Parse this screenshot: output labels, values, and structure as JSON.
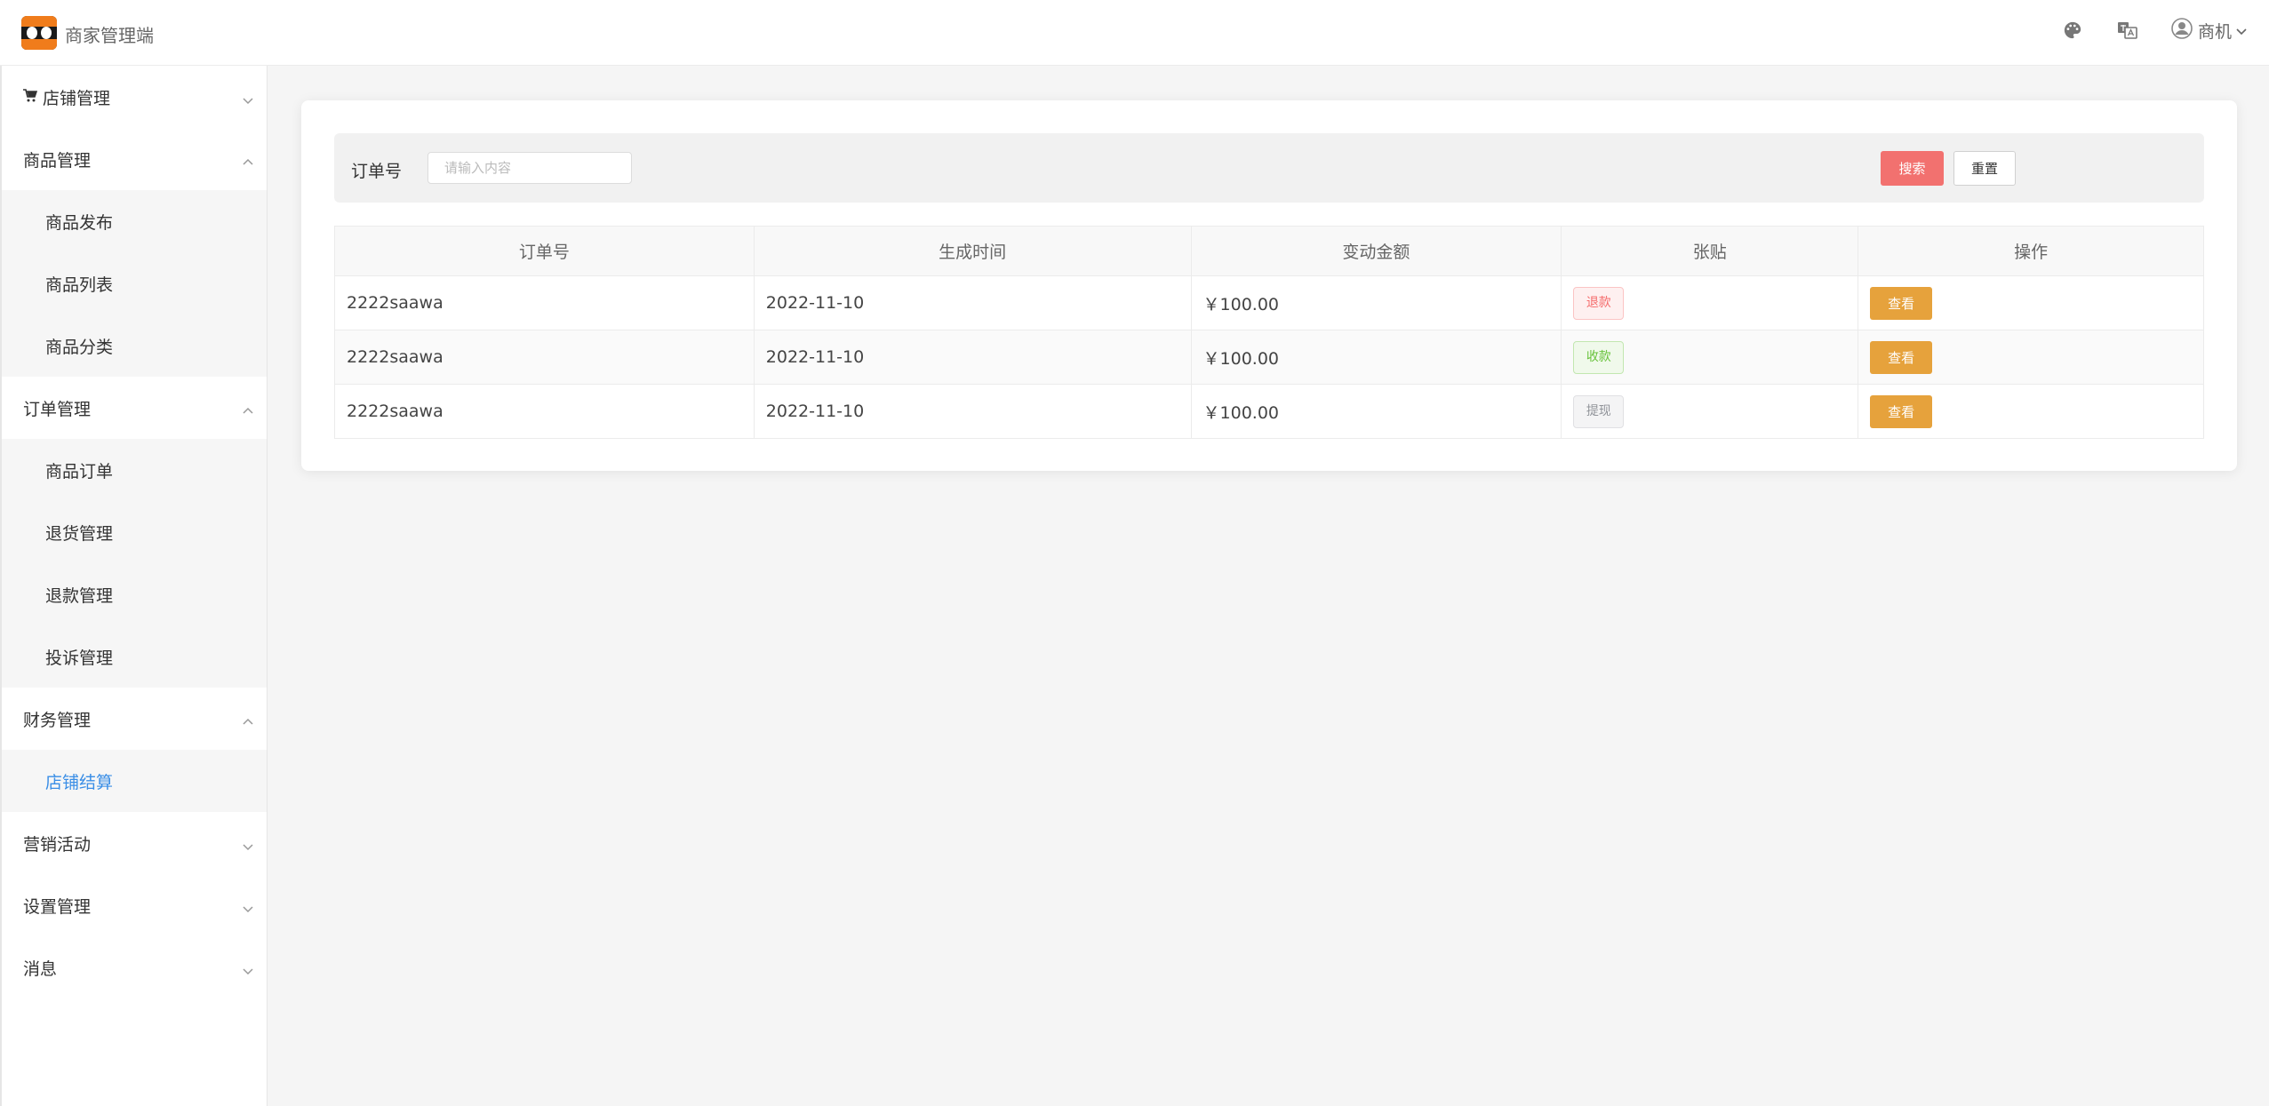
{
  "header": {
    "app_title": "商家管理端",
    "user_name": "商机"
  },
  "sidebar": {
    "groups": [
      {
        "label": "店铺管理",
        "expanded": false
      },
      {
        "label": "商品管理",
        "expanded": true,
        "items": [
          "商品发布",
          "商品列表",
          "商品分类"
        ]
      },
      {
        "label": "订单管理",
        "expanded": true,
        "items": [
          "商品订单",
          "退货管理",
          "退款管理",
          "投诉管理"
        ]
      },
      {
        "label": "财务管理",
        "expanded": true,
        "items": [
          "店铺结算"
        ],
        "active_item": "店铺结算"
      },
      {
        "label": "营销活动",
        "expanded": false
      },
      {
        "label": "设置管理",
        "expanded": false
      },
      {
        "label": "消息",
        "expanded": false
      }
    ]
  },
  "search": {
    "label": "订单号",
    "placeholder": "请输入内容",
    "value": "",
    "search_label": "搜索",
    "reset_label": "重置"
  },
  "table": {
    "columns": [
      "订单号",
      "生成时间",
      "变动金额",
      "张贴",
      "操作"
    ],
    "rows": [
      {
        "order_no": "2222saawa",
        "time": "2022-11-10",
        "amount": "￥100.00",
        "tag": "退款",
        "tag_color": "#f56c6c",
        "action": "查看"
      },
      {
        "order_no": "2222saawa",
        "time": "2022-11-10",
        "amount": "￥100.00",
        "tag": "收款",
        "tag_color": "#67c23a",
        "action": "查看"
      },
      {
        "order_no": "2222saawa",
        "time": "2022-11-10",
        "amount": "￥100.00",
        "tag": "提现",
        "tag_color": "#909399",
        "action": "查看"
      }
    ]
  },
  "colors": {
    "search_button": "#f2716f",
    "view_button": "#e6a23c",
    "active_menu": "#3a8ee6"
  },
  "icons": {
    "header": [
      "palette-icon",
      "translate-icon",
      "user-avatar-icon",
      "chevron-down-icon"
    ],
    "sidebar": [
      "cart-icon",
      "chevron-down-icon",
      "chevron-up-icon"
    ]
  }
}
